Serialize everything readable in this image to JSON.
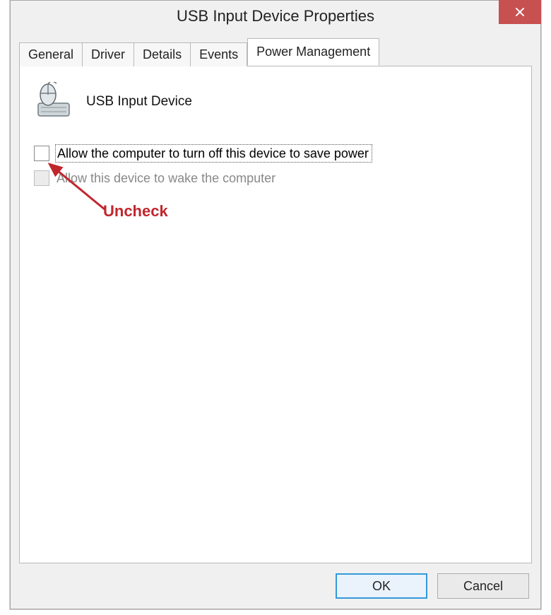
{
  "window": {
    "title": "USB Input Device Properties",
    "close_glyph": "✕"
  },
  "tabs": [
    {
      "label": "General"
    },
    {
      "label": "Driver"
    },
    {
      "label": "Details"
    },
    {
      "label": "Events"
    },
    {
      "label": "Power Management",
      "active": true
    }
  ],
  "device": {
    "name": "USB Input Device",
    "icon": "mouse-keyboard-icon"
  },
  "options": {
    "allow_turn_off": {
      "label": "Allow the computer to turn off this device to save power",
      "checked": false,
      "enabled": true,
      "focused": true
    },
    "allow_wake": {
      "label": "Allow this device to wake the computer",
      "checked": false,
      "enabled": false,
      "focused": false
    }
  },
  "buttons": {
    "ok": "OK",
    "cancel": "Cancel"
  },
  "annotation": {
    "text": "Uncheck",
    "color": "#c0272d"
  }
}
